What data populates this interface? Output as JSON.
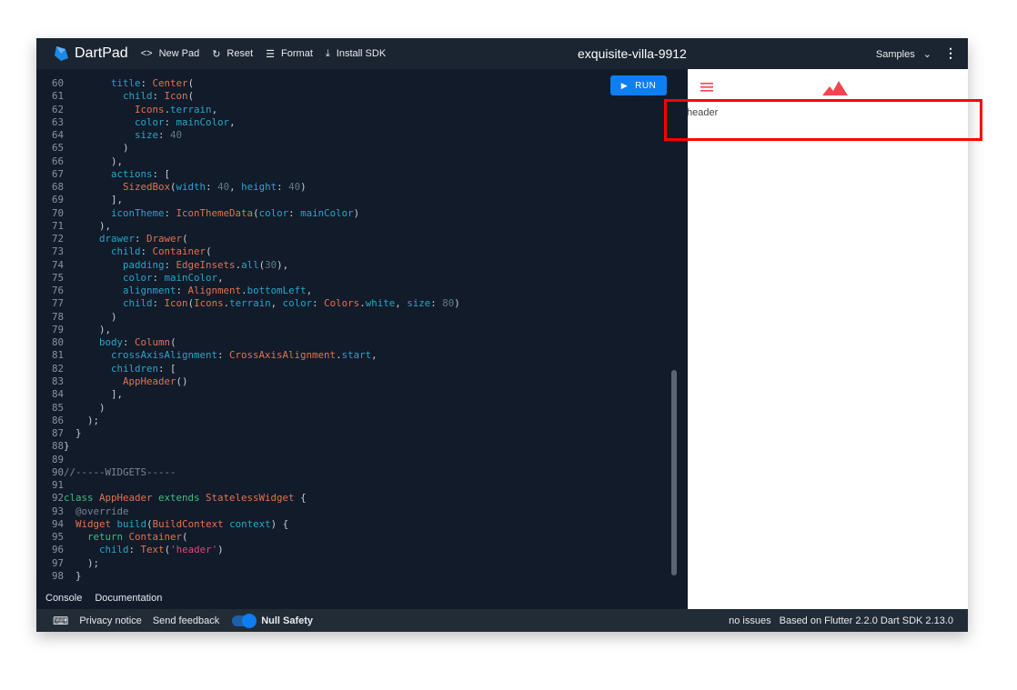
{
  "header": {
    "app_name": "DartPad",
    "new_pad": "New Pad",
    "reset": "Reset",
    "format": "Format",
    "install_sdk": "Install SDK",
    "pad_title": "exquisite-villa-9912",
    "samples": "Samples"
  },
  "editor": {
    "run_label": "RUN",
    "first_line": 60,
    "lines": [
      [
        [
          "d",
          "        "
        ],
        [
          "p",
          "title"
        ],
        [
          "d",
          ": "
        ],
        [
          "t",
          "Center"
        ],
        [
          "d",
          "("
        ]
      ],
      [
        [
          "d",
          "          "
        ],
        [
          "p",
          "child"
        ],
        [
          "d",
          ": "
        ],
        [
          "t",
          "Icon"
        ],
        [
          "d",
          "("
        ]
      ],
      [
        [
          "d",
          "            "
        ],
        [
          "t",
          "Icons"
        ],
        [
          "d",
          "."
        ],
        [
          "p",
          "terrain"
        ],
        [
          "d",
          ","
        ]
      ],
      [
        [
          "d",
          "            "
        ],
        [
          "p",
          "color"
        ],
        [
          "d",
          ": "
        ],
        [
          "p",
          "mainColor"
        ],
        [
          "d",
          ","
        ]
      ],
      [
        [
          "d",
          "            "
        ],
        [
          "p",
          "size"
        ],
        [
          "d",
          ": "
        ],
        [
          "n",
          "40"
        ]
      ],
      [
        [
          "d",
          "          )"
        ]
      ],
      [
        [
          "d",
          "        ),"
        ]
      ],
      [
        [
          "d",
          "        "
        ],
        [
          "p",
          "actions"
        ],
        [
          "d",
          ": ["
        ]
      ],
      [
        [
          "d",
          "          "
        ],
        [
          "t",
          "SizedBox"
        ],
        [
          "d",
          "("
        ],
        [
          "p",
          "width"
        ],
        [
          "d",
          ": "
        ],
        [
          "n",
          "40"
        ],
        [
          "d",
          ", "
        ],
        [
          "p",
          "height"
        ],
        [
          "d",
          ": "
        ],
        [
          "n",
          "40"
        ],
        [
          "d",
          ")"
        ]
      ],
      [
        [
          "d",
          "        ],"
        ]
      ],
      [
        [
          "d",
          "        "
        ],
        [
          "p",
          "iconTheme"
        ],
        [
          "d",
          ": "
        ],
        [
          "t",
          "IconThemeData"
        ],
        [
          "d",
          "("
        ],
        [
          "p",
          "color"
        ],
        [
          "d",
          ": "
        ],
        [
          "p",
          "mainColor"
        ],
        [
          "d",
          ")"
        ]
      ],
      [
        [
          "d",
          "      ),"
        ]
      ],
      [
        [
          "d",
          "      "
        ],
        [
          "p",
          "drawer"
        ],
        [
          "d",
          ": "
        ],
        [
          "t",
          "Drawer"
        ],
        [
          "d",
          "("
        ]
      ],
      [
        [
          "d",
          "        "
        ],
        [
          "p",
          "child"
        ],
        [
          "d",
          ": "
        ],
        [
          "t",
          "Container"
        ],
        [
          "d",
          "("
        ]
      ],
      [
        [
          "d",
          "          "
        ],
        [
          "p",
          "padding"
        ],
        [
          "d",
          ": "
        ],
        [
          "t",
          "EdgeInsets"
        ],
        [
          "d",
          "."
        ],
        [
          "p",
          "all"
        ],
        [
          "d",
          "("
        ],
        [
          "n",
          "30"
        ],
        [
          "d",
          "),"
        ]
      ],
      [
        [
          "d",
          "          "
        ],
        [
          "p",
          "color"
        ],
        [
          "d",
          ": "
        ],
        [
          "p",
          "mainColor"
        ],
        [
          "d",
          ","
        ]
      ],
      [
        [
          "d",
          "          "
        ],
        [
          "p",
          "alignment"
        ],
        [
          "d",
          ": "
        ],
        [
          "t",
          "Alignment"
        ],
        [
          "d",
          "."
        ],
        [
          "p",
          "bottomLeft"
        ],
        [
          "d",
          ","
        ]
      ],
      [
        [
          "d",
          "          "
        ],
        [
          "p",
          "child"
        ],
        [
          "d",
          ": "
        ],
        [
          "t",
          "Icon"
        ],
        [
          "d",
          "("
        ],
        [
          "t",
          "Icons"
        ],
        [
          "d",
          "."
        ],
        [
          "p",
          "terrain"
        ],
        [
          "d",
          ", "
        ],
        [
          "p",
          "color"
        ],
        [
          "d",
          ": "
        ],
        [
          "t",
          "Colors"
        ],
        [
          "d",
          "."
        ],
        [
          "p",
          "white"
        ],
        [
          "d",
          ", "
        ],
        [
          "p",
          "size"
        ],
        [
          "d",
          ": "
        ],
        [
          "n",
          "80"
        ],
        [
          "d",
          ")"
        ]
      ],
      [
        [
          "d",
          "        )"
        ]
      ],
      [
        [
          "d",
          "      ),"
        ]
      ],
      [
        [
          "d",
          "      "
        ],
        [
          "p",
          "body"
        ],
        [
          "d",
          ": "
        ],
        [
          "t",
          "Column"
        ],
        [
          "d",
          "("
        ]
      ],
      [
        [
          "d",
          "        "
        ],
        [
          "p",
          "crossAxisAlignment"
        ],
        [
          "d",
          ": "
        ],
        [
          "t",
          "CrossAxisAlignment"
        ],
        [
          "d",
          "."
        ],
        [
          "p",
          "start"
        ],
        [
          "d",
          ","
        ]
      ],
      [
        [
          "d",
          "        "
        ],
        [
          "p",
          "children"
        ],
        [
          "d",
          ": ["
        ]
      ],
      [
        [
          "d",
          "          "
        ],
        [
          "t",
          "AppHeader"
        ],
        [
          "d",
          "()"
        ]
      ],
      [
        [
          "d",
          "        ],"
        ]
      ],
      [
        [
          "d",
          "      )"
        ]
      ],
      [
        [
          "d",
          "    );"
        ]
      ],
      [
        [
          "d",
          "  }"
        ]
      ],
      [
        [
          "d",
          "}"
        ]
      ],
      [],
      [
        [
          "c",
          "//-----WIDGETS-----"
        ]
      ],
      [],
      [
        [
          "k",
          "class "
        ],
        [
          "t",
          "AppHeader"
        ],
        [
          "k",
          " extends "
        ],
        [
          "t",
          "StatelessWidget"
        ],
        [
          "d",
          " {"
        ]
      ],
      [
        [
          "d",
          "  "
        ],
        [
          "c",
          "@override"
        ]
      ],
      [
        [
          "d",
          "  "
        ],
        [
          "t",
          "Widget"
        ],
        [
          "d",
          " "
        ],
        [
          "p",
          "build"
        ],
        [
          "d",
          "("
        ],
        [
          "t",
          "BuildContext"
        ],
        [
          "d",
          " "
        ],
        [
          "p",
          "context"
        ],
        [
          "d",
          ") {"
        ]
      ],
      [
        [
          "d",
          "    "
        ],
        [
          "k",
          "return "
        ],
        [
          "t",
          "Container"
        ],
        [
          "d",
          "("
        ]
      ],
      [
        [
          "d",
          "      "
        ],
        [
          "p",
          "child"
        ],
        [
          "d",
          ": "
        ],
        [
          "t",
          "Text"
        ],
        [
          "d",
          "("
        ],
        [
          "s",
          "'header'"
        ],
        [
          "d",
          ")"
        ]
      ],
      [
        [
          "d",
          "    );"
        ]
      ],
      [
        [
          "d",
          "  }"
        ]
      ]
    ]
  },
  "tabs": {
    "console": "Console",
    "documentation": "Documentation"
  },
  "footer": {
    "privacy": "Privacy notice",
    "feedback": "Send feedback",
    "null_safety": "Null Safety",
    "null_safety_on": true,
    "issues": "no issues",
    "version": "Based on Flutter 2.2.0 Dart SDK 2.13.0"
  },
  "preview": {
    "body_text": "header",
    "accent": "#f5444f"
  },
  "colors": {
    "run": "#0d7ff2",
    "highlight": "#ff0000"
  }
}
